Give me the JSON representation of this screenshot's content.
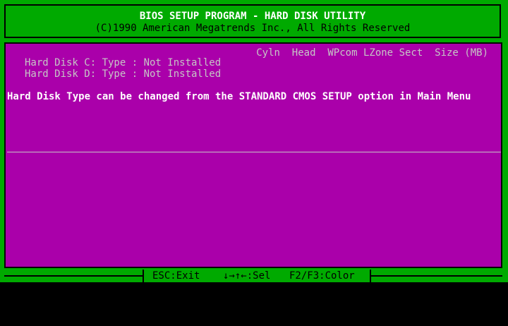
{
  "header": {
    "title": "BIOS SETUP PROGRAM - HARD DISK UTILITY",
    "copyright": "(C)1990 American Megatrends Inc., All Rights Reserved"
  },
  "panel": {
    "columns": [
      "Cyln",
      "Head",
      "WPcom",
      "LZone",
      "Sect",
      "Size (MB)"
    ],
    "disks": [
      {
        "label": "Hard Disk C: Type : Not Installed"
      },
      {
        "label": "Hard Disk D: Type : Not Installed"
      }
    ],
    "message": "Hard Disk Type can be changed from the STANDARD CMOS SETUP option in Main Menu"
  },
  "statusbar": {
    "esc": "ESC:Exit",
    "nav": "↓→↑←:Sel",
    "color": "F2/F3:Color"
  },
  "colors": {
    "background": "#00aa00",
    "panel": "#aa00aa",
    "text_dim": "#c6c6c6",
    "text_bright": "#ffffff"
  }
}
